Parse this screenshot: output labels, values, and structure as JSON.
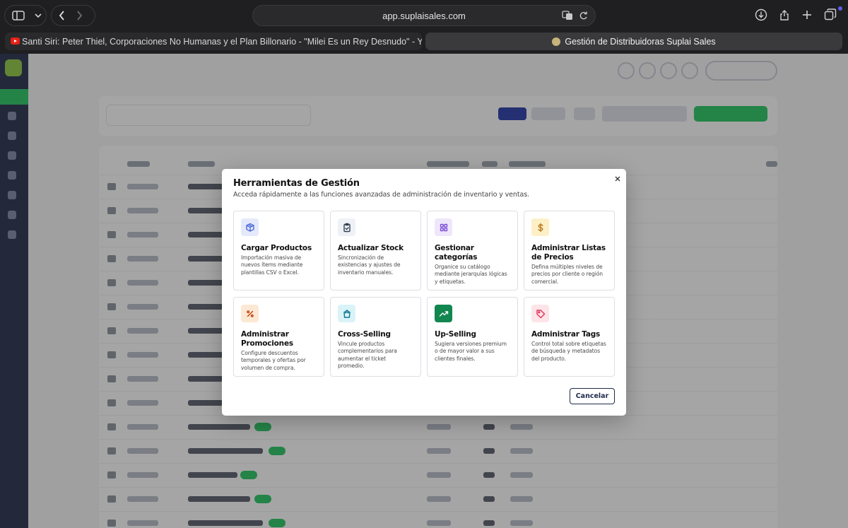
{
  "browser": {
    "url": "app.suplaisales.com",
    "tabs": [
      {
        "title": "Santi Siri: Peter Thiel, Corporaciones No Humanas y el Plan Billonario - \"Milei Es un Rey Desnudo\" - You..."
      },
      {
        "title": "Gestión de Distribuidoras Suplai Sales"
      }
    ]
  },
  "modal": {
    "title": "Herramientas de Gestión",
    "subtitle": "Acceda rápidamente a las funciones avanzadas de administración de inventario y ventas.",
    "cancel_label": "Cancelar",
    "cards": [
      {
        "title": "Cargar Productos",
        "description": "Importación masiva de nuevos ítems mediante plantillas CSV o Excel.",
        "icon": "package-icon",
        "color": "#4f6bd8",
        "bg": "#e4e9fb"
      },
      {
        "title": "Actualizar Stock",
        "description": "Sincronización de existencias y ajustes de inventario manuales.",
        "icon": "clipboard-icon",
        "color": "#334155",
        "bg": "#eef1f5"
      },
      {
        "title": "Gestionar categorías",
        "description": "Organice su catálogo mediante jerarquías lógicas y etiquetas.",
        "icon": "grid-icon",
        "color": "#7c4dd8",
        "bg": "#efe6fb"
      },
      {
        "title": "Administrar Listas de Precios",
        "description": "Defina múltiples niveles de precios por cliente o región comercial.",
        "icon": "dollar-icon",
        "color": "#b7791f",
        "bg": "#fdf0c6"
      },
      {
        "title": "Administrar Promociones",
        "description": "Configure descuentos temporales y ofertas por volumen de compra.",
        "icon": "percent-icon",
        "color": "#c2410c",
        "bg": "#fde8d4"
      },
      {
        "title": "Cross-Selling",
        "description": "Vincule productos complementarios para aumentar el ticket promedio.",
        "icon": "shopping-bag-icon",
        "color": "#0e7490",
        "bg": "#d9f3f8"
      },
      {
        "title": "Up-Selling",
        "description": "Sugiera versiones premium o de mayor valor a sus clientes finales.",
        "icon": "trending-up-icon",
        "color": "#ffffff",
        "bg": "#12864f"
      },
      {
        "title": "Administrar Tags",
        "description": "Control total sobre etiquetas de búsqueda y metadatos del producto.",
        "icon": "tag-icon",
        "color": "#e0345a",
        "bg": "#fde4e8"
      }
    ]
  }
}
